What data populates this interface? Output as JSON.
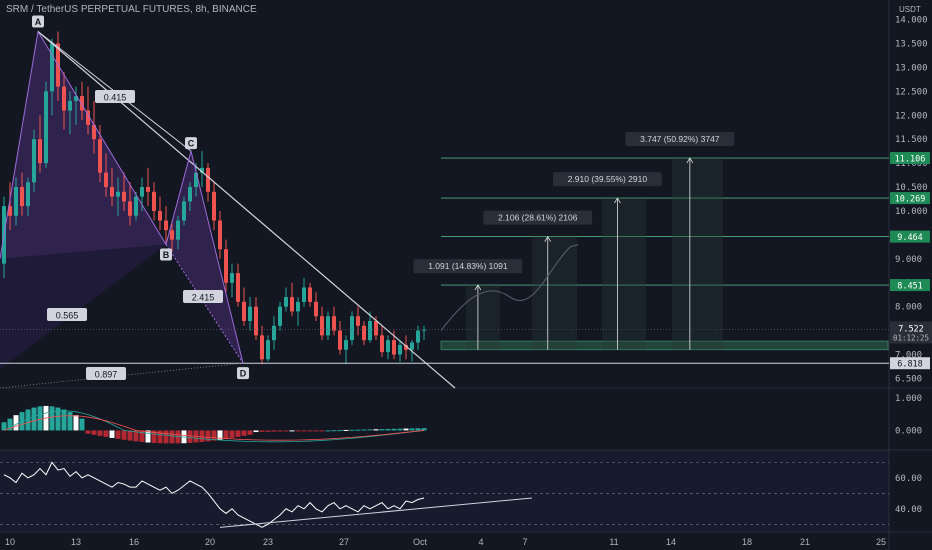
{
  "title": "SRM / TetherUS PERPETUAL FUTURES, 8h, BINANCE",
  "currency": "USDT",
  "colors": {
    "bg": "#131722",
    "up": "#26a69a",
    "down": "#ef5350",
    "grid": "#1e222d",
    "text": "#b2b5be",
    "accent": "#2962ff"
  },
  "chart_data": [
    {
      "type": "candlestick",
      "name": "price",
      "ylim": [
        6.3,
        14.2
      ],
      "y_ticks": [
        "14.000",
        "13.500",
        "13.000",
        "12.500",
        "12.000",
        "11.500",
        "11.000",
        "10.500",
        "10.000",
        "9.500",
        "9.000",
        "8.500",
        "8.000",
        "7.500",
        "7.000",
        "6.500"
      ],
      "x_ticks": [
        "10",
        "13",
        "16",
        "20",
        "23",
        "27",
        "Oct",
        "4",
        "7",
        "11",
        "14",
        "18",
        "21",
        "25"
      ],
      "candles": [
        [
          8.9,
          10.3,
          8.6,
          10.1
        ],
        [
          10.1,
          10.6,
          9.6,
          9.9
        ],
        [
          9.9,
          10.7,
          9.7,
          10.5
        ],
        [
          10.5,
          10.8,
          9.9,
          10.1
        ],
        [
          10.1,
          10.7,
          9.9,
          10.6
        ],
        [
          10.6,
          11.7,
          10.4,
          11.5
        ],
        [
          11.5,
          12.0,
          10.8,
          11.0
        ],
        [
          11.0,
          12.7,
          10.9,
          12.5
        ],
        [
          12.5,
          13.6,
          12.0,
          13.5
        ],
        [
          13.5,
          13.75,
          12.3,
          12.6
        ],
        [
          12.6,
          12.9,
          11.7,
          12.1
        ],
        [
          12.1,
          12.5,
          11.6,
          12.3
        ],
        [
          12.3,
          12.6,
          11.8,
          12.4
        ],
        [
          12.4,
          12.7,
          11.9,
          12.1
        ],
        [
          12.1,
          12.6,
          11.6,
          11.8
        ],
        [
          11.8,
          12.3,
          11.2,
          11.5
        ],
        [
          11.5,
          11.8,
          10.6,
          10.8
        ],
        [
          10.8,
          11.2,
          10.3,
          10.5
        ],
        [
          10.5,
          10.9,
          10.1,
          10.3
        ],
        [
          10.3,
          10.7,
          9.9,
          10.4
        ],
        [
          10.4,
          10.8,
          10.0,
          10.2
        ],
        [
          10.2,
          10.6,
          9.7,
          9.9
        ],
        [
          9.9,
          10.4,
          9.8,
          10.3
        ],
        [
          10.3,
          10.7,
          10.0,
          10.5
        ],
        [
          10.5,
          10.9,
          10.1,
          10.4
        ],
        [
          10.4,
          10.6,
          9.8,
          10.0
        ],
        [
          10.0,
          10.3,
          9.6,
          9.8
        ],
        [
          9.8,
          10.1,
          9.3,
          9.6
        ],
        [
          9.6,
          9.8,
          9.15,
          9.4
        ],
        [
          9.4,
          9.9,
          9.2,
          9.8
        ],
        [
          9.8,
          10.3,
          9.7,
          10.2
        ],
        [
          10.2,
          10.6,
          10.0,
          10.5
        ],
        [
          10.5,
          11.0,
          10.3,
          10.8
        ],
        [
          10.8,
          11.25,
          10.5,
          10.9
        ],
        [
          10.9,
          11.0,
          10.2,
          10.4
        ],
        [
          10.4,
          10.6,
          9.6,
          9.8
        ],
        [
          9.8,
          10.0,
          9.0,
          9.2
        ],
        [
          9.2,
          9.4,
          8.3,
          8.5
        ],
        [
          8.5,
          8.9,
          8.2,
          8.7
        ],
        [
          8.7,
          8.9,
          8.0,
          8.1
        ],
        [
          8.1,
          8.4,
          7.6,
          7.7
        ],
        [
          7.7,
          8.2,
          7.5,
          8.0
        ],
        [
          8.0,
          8.2,
          7.3,
          7.4
        ],
        [
          7.4,
          7.6,
          6.8,
          6.9
        ],
        [
          6.9,
          7.4,
          6.85,
          7.3
        ],
        [
          7.3,
          7.8,
          7.1,
          7.6
        ],
        [
          7.6,
          8.1,
          7.5,
          8.0
        ],
        [
          8.0,
          8.4,
          7.9,
          8.2
        ],
        [
          8.2,
          8.5,
          7.8,
          7.9
        ],
        [
          7.9,
          8.2,
          7.6,
          8.1
        ],
        [
          8.1,
          8.6,
          8.0,
          8.4
        ],
        [
          8.4,
          8.5,
          8.0,
          8.1
        ],
        [
          8.1,
          8.3,
          7.7,
          7.8
        ],
        [
          7.8,
          8.0,
          7.3,
          7.4
        ],
        [
          7.4,
          7.9,
          7.3,
          7.8
        ],
        [
          7.8,
          8.0,
          7.4,
          7.5
        ],
        [
          7.5,
          7.7,
          7.0,
          7.1
        ],
        [
          7.1,
          7.4,
          6.8,
          7.3
        ],
        [
          7.3,
          7.9,
          7.2,
          7.8
        ],
        [
          7.8,
          8.0,
          7.4,
          7.6
        ],
        [
          7.6,
          7.7,
          7.2,
          7.3
        ],
        [
          7.3,
          7.9,
          7.25,
          7.7
        ],
        [
          7.7,
          7.8,
          7.3,
          7.4
        ],
        [
          7.4,
          7.6,
          6.95,
          7.05
        ],
        [
          7.05,
          7.4,
          6.9,
          7.3
        ],
        [
          7.3,
          7.5,
          6.9,
          7.0
        ],
        [
          7.0,
          7.3,
          6.85,
          7.2
        ],
        [
          7.2,
          7.4,
          6.9,
          7.1
        ],
        [
          7.1,
          7.3,
          6.85,
          7.25
        ],
        [
          7.25,
          7.6,
          7.1,
          7.5
        ],
        [
          7.5,
          7.6,
          7.3,
          7.52
        ]
      ],
      "harmonic_points": [
        {
          "label": "A",
          "price": 13.75
        },
        {
          "label": "B",
          "price": 9.3
        },
        {
          "label": "C",
          "price": 11.25
        },
        {
          "label": "D",
          "price": 6.82
        }
      ],
      "ratios": [
        "0.415",
        "0.565",
        "2.415",
        "0.897"
      ],
      "targets": [
        {
          "price": "8.451",
          "label": "1.091 (14.83%) 1091"
        },
        {
          "price": "9.464",
          "label": "2.106 (28.61%) 2106"
        },
        {
          "price": "10.269",
          "label": "2.910 (39.55%) 2910"
        },
        {
          "price": "11.106",
          "label": "3.747 (50.92%) 3747"
        }
      ],
      "support": "6.818",
      "last_price": "7.522",
      "countdown": "01:12:25"
    },
    {
      "type": "histogram",
      "name": "macd",
      "ylim": [
        -0.6,
        1.3
      ],
      "y_ticks": [
        "1.000",
        "0.000"
      ]
    },
    {
      "type": "line",
      "name": "rsi",
      "ylim": [
        25,
        78
      ],
      "y_ticks": [
        "60.00",
        "40.00"
      ],
      "bands": [
        70,
        50,
        30
      ],
      "values": [
        62,
        60,
        57,
        63,
        60,
        62,
        66,
        62,
        70,
        65,
        66,
        61,
        64,
        60,
        62,
        60,
        58,
        56,
        54,
        57,
        56,
        54,
        54,
        58,
        56,
        54,
        52,
        54,
        50,
        52,
        55,
        58,
        56,
        54,
        50,
        45,
        40,
        37,
        40,
        36,
        34,
        32,
        30,
        28,
        30,
        33,
        36,
        40,
        38,
        42,
        40,
        44,
        40,
        38,
        42,
        44,
        40,
        42,
        40,
        38,
        42,
        40,
        42,
        44,
        40,
        42,
        40,
        45,
        44,
        46,
        47
      ],
      "trendline": [
        [
          42,
          28
        ],
        [
          96,
          47
        ]
      ]
    }
  ]
}
